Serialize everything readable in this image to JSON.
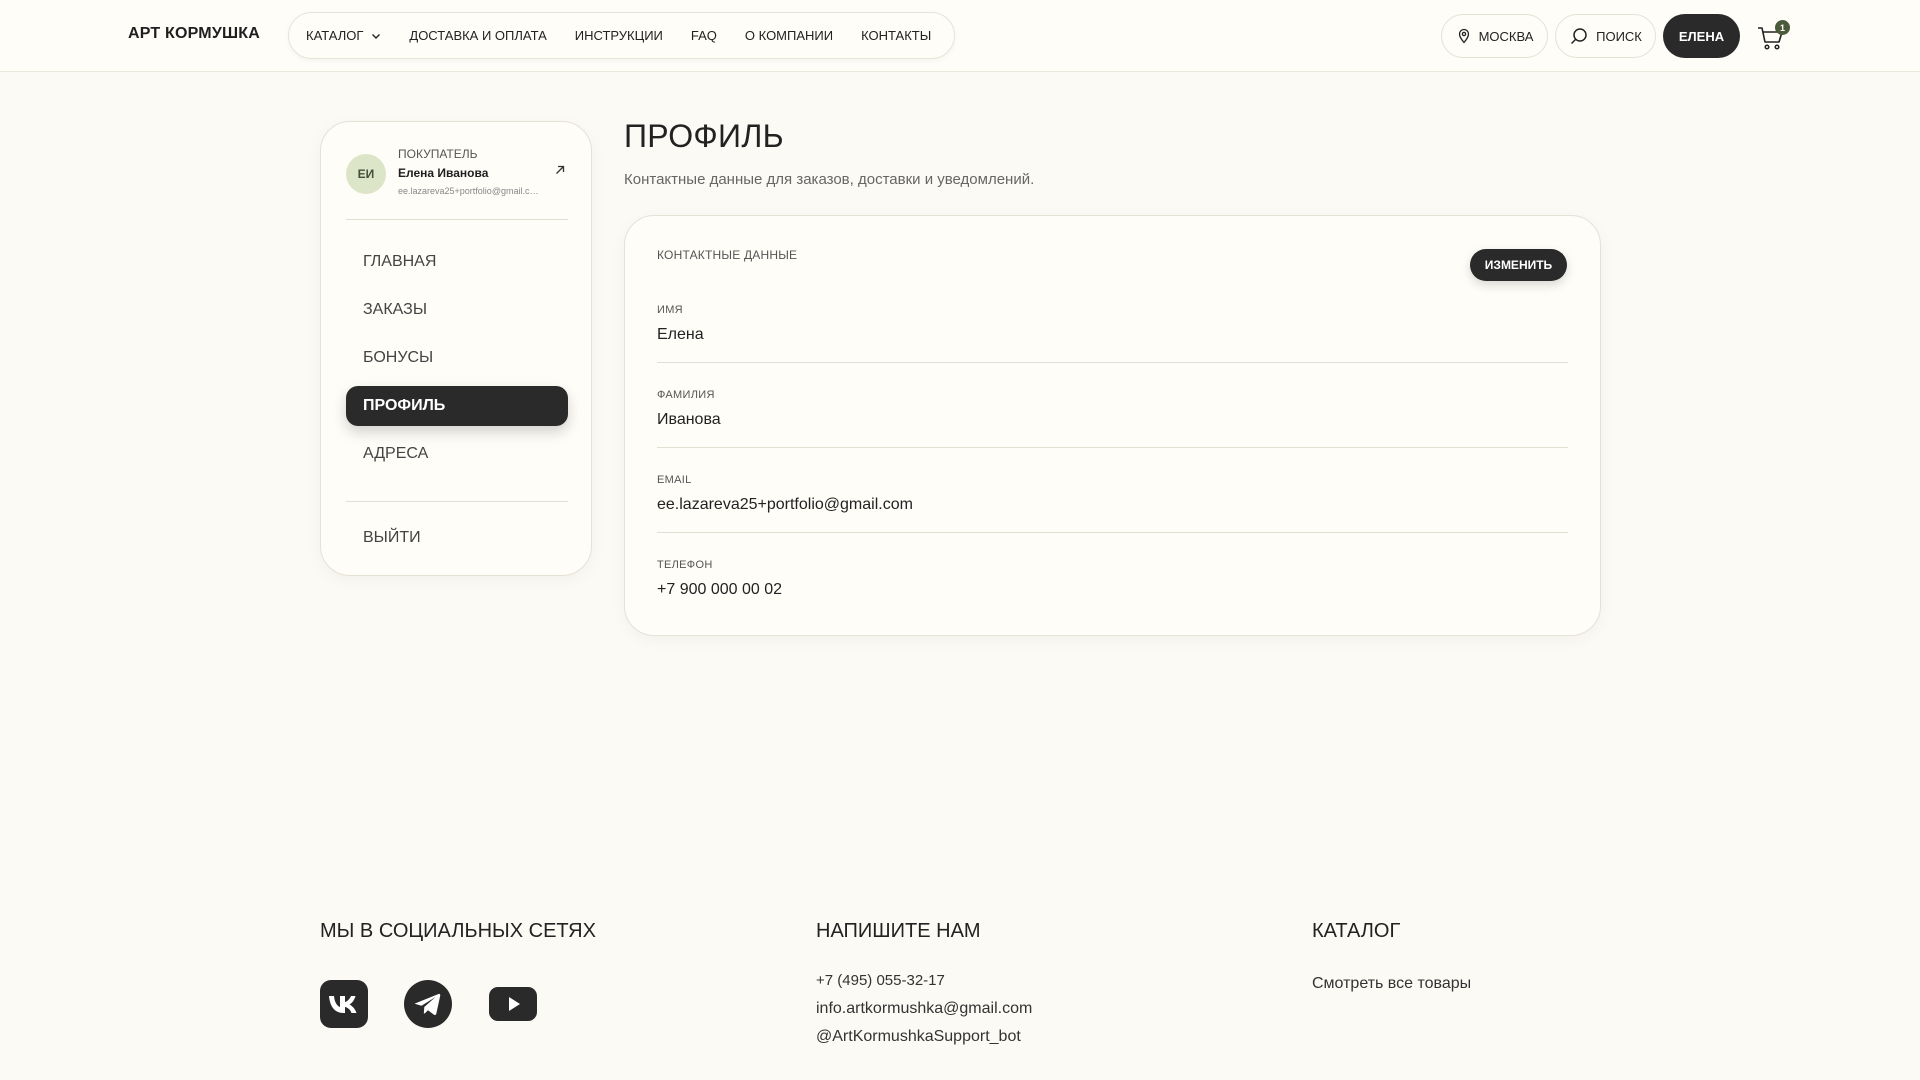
{
  "header": {
    "logo": "АРТ КОРМУШКА",
    "nav": [
      {
        "label": "КАТАЛОГ"
      },
      {
        "label": "ДОСТАВКА И ОПЛАТА"
      },
      {
        "label": "ИНСТРУКЦИИ"
      },
      {
        "label": "FAQ"
      },
      {
        "label": "О КОМПАНИИ"
      },
      {
        "label": "КОНТАКТЫ"
      }
    ],
    "city": "МОСКВА",
    "search": "ПОИСК",
    "user": "ЕЛЕНА",
    "cart_count": "1"
  },
  "sidebar": {
    "avatar_initials": "ЕИ",
    "role": "ПОКУПАТЕЛЬ",
    "name": "Елена Иванова",
    "email": "ee.lazareva25+portfolio@gmail.com",
    "items": [
      {
        "label": "ГЛАВНАЯ",
        "active": false
      },
      {
        "label": "ЗАКАЗЫ",
        "active": false
      },
      {
        "label": "БОНУСЫ",
        "active": false
      },
      {
        "label": "ПРОФИЛЬ",
        "active": true
      },
      {
        "label": "АДРЕСА",
        "active": false
      }
    ],
    "logout": "ВЫЙТИ"
  },
  "main": {
    "title": "ПРОФИЛЬ",
    "subtitle": "Контактные данные для заказов, доставки и уведомлений.",
    "card": {
      "title": "КОНТАКТНЫЕ ДАННЫЕ",
      "edit_label": "ИЗМЕНИТЬ",
      "fields": [
        {
          "label": "ИМЯ",
          "value": "Елена"
        },
        {
          "label": "ФАМИЛИЯ",
          "value": "Иванова"
        },
        {
          "label": "EMAIL",
          "value": "ee.lazareva25+portfolio@gmail.com"
        },
        {
          "label": "ТЕЛЕФОН",
          "value": "+7 900 000 00 02"
        }
      ]
    }
  },
  "footer": {
    "social": {
      "title": "МЫ В СОЦИАЛЬНЫХ СЕТЯХ",
      "icons": [
        "vk-icon",
        "telegram-icon",
        "youtube-icon"
      ]
    },
    "contact": {
      "title": "НАПИШИТЕ НАМ",
      "phone": "+7 (495) 055-32-17",
      "email": "info.artkormushka@gmail.com",
      "bot": "@ArtKormushkaSupport_bot"
    },
    "catalog": {
      "title": "КАТАЛОГ",
      "link": "Смотреть все товары"
    }
  },
  "colors": {
    "background": "#fcfaf4",
    "dark": "#2a2a2a",
    "avatar_bg": "#dde5c8",
    "badge": "#4a5a3a"
  }
}
